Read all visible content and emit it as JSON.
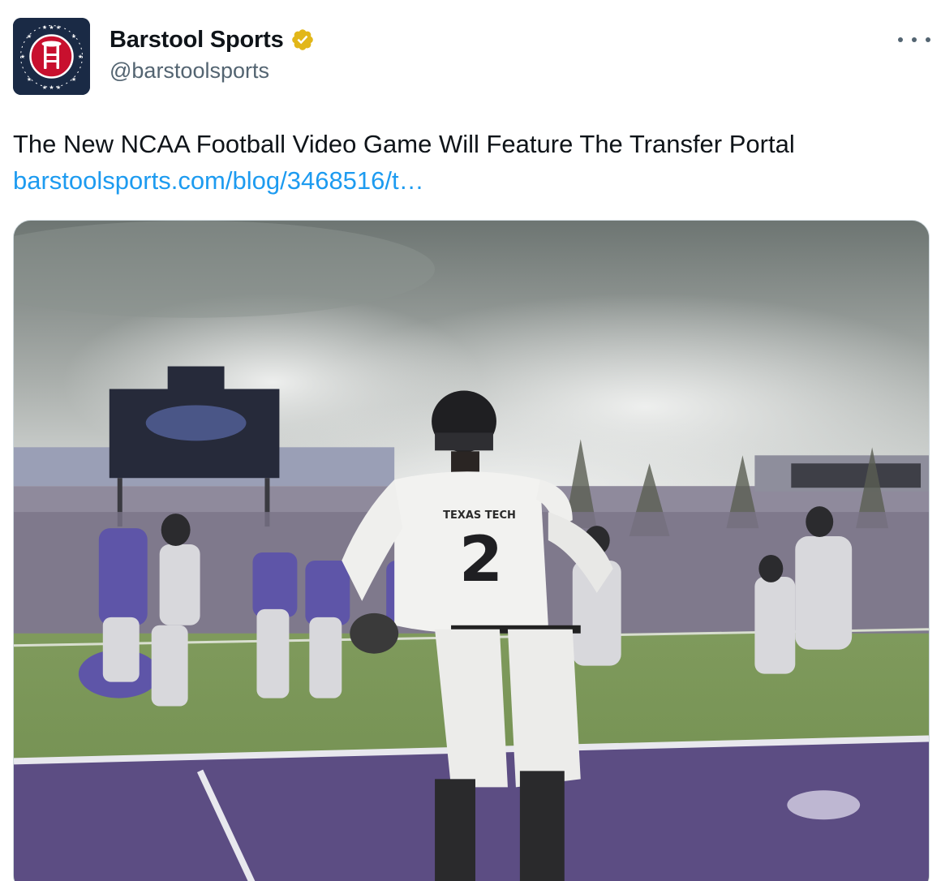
{
  "author": {
    "display_name": "Barstool Sports",
    "handle": "@barstoolsports",
    "avatar_icon": "barstool-stool-logo-icon",
    "verified_icon": "verified-badge-icon",
    "verified_color": "#e2b719"
  },
  "menu": {
    "icon": "more-horizontal-icon"
  },
  "tweet": {
    "text": "The New NCAA Football Video Game Will Feature The Transfer Portal",
    "link": "barstoolsports.com/blog/3468516/t…"
  },
  "media": {
    "jersey_number": "2",
    "jersey_text": "TEXAS TECH"
  },
  "colors": {
    "link": "#1d9bf0",
    "secondary_text": "#536471",
    "avatar_bg": "#1a2a45",
    "logo_red": "#c8102e"
  }
}
